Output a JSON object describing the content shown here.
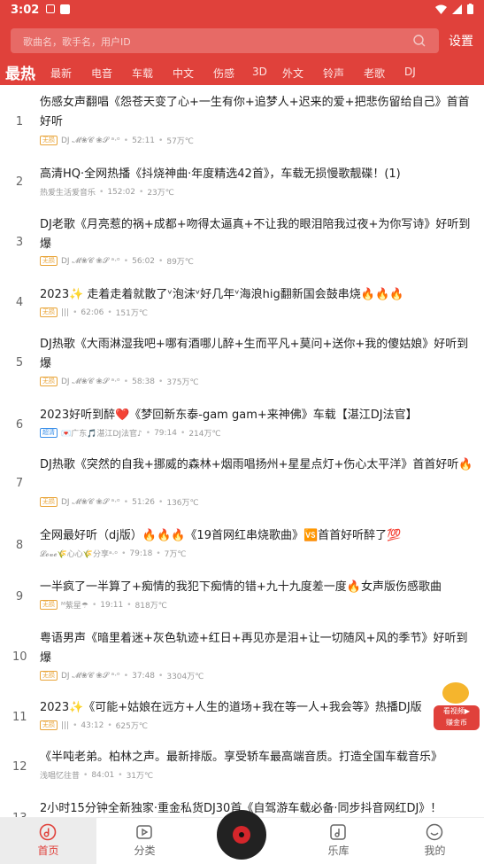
{
  "status_bar": {
    "time": "3:02"
  },
  "search": {
    "placeholder": "歌曲名，歌手名，用户ID"
  },
  "settings_label": "设置",
  "tabs": [
    "最热",
    "最新",
    "电音",
    "车载",
    "中文",
    "伤感",
    "3D",
    "外文",
    "铃声",
    "老歌",
    "DJ"
  ],
  "songs": [
    {
      "num": "1",
      "title": "伤感女声翻唱《怨苍天变了心+一生有你+追梦人+迟来的爱+把悲伤留给自己》首首好听",
      "badge": "无损",
      "uploader": "DJ 𝓜❀𝓒 ❀𝓢 ᵃ·ᵒ",
      "duration": "52:11",
      "plays": "57万℃"
    },
    {
      "num": "2",
      "title": "高清HQ·全网热播《抖烧神曲·年度精选42首》，车载无损慢歌靓碟！(1)",
      "badge": "",
      "uploader": "热爱生活爱音乐",
      "duration": "152:02",
      "plays": "23万℃"
    },
    {
      "num": "3",
      "title": "DJ老歌《月亮惹的祸+成都+吻得太逼真+不让我的眼泪陪我过夜+为你写诗》好听到爆",
      "badge": "无损",
      "uploader": "DJ 𝓜❀𝓒 ❀𝓢 ᵃ·ᵒ",
      "duration": "56:02",
      "plays": "89万℃"
    },
    {
      "num": "4",
      "title": "2023✨ 走着走着就散了ᵛ泡沫ᵛ好几年ᵛ海浪hig翻新国会鼓串烧🔥🔥🔥",
      "badge": "无损",
      "uploader": "|||",
      "duration": "62:06",
      "plays": "151万℃"
    },
    {
      "num": "5",
      "title": "DJ热歌《大雨淋湿我吧+哪有酒哪儿醉+生而平凡+莫问+送你+我的傻姑娘》好听到爆",
      "badge": "无损",
      "uploader": "DJ 𝓜❀𝓒 ❀𝓢 ᵃ·ᵒ",
      "duration": "58:38",
      "plays": "375万℃"
    },
    {
      "num": "6",
      "title": "2023好听到醉❤️《梦回新东泰-gam gam+来神佛》车载【湛江DJ法官】",
      "badge": "超清",
      "uploader": "💌广东🎵湛江DJ法官♪",
      "duration": "79:14",
      "plays": "214万℃"
    },
    {
      "num": "7",
      "title": "DJ热歌《突然的自我+挪威的森林+烟雨唱扬州+星星点灯+伤心太平洋》首首好听🔥",
      "badge": "无损",
      "uploader": "DJ 𝓜❀𝓒 ❀𝓢 ᵃ·ᵒ",
      "duration": "51:26",
      "plays": "136万℃"
    },
    {
      "num": "8",
      "title": "全网最好听（dj版）🔥🔥🔥《19首网红串烧歌曲》🆚首首好听醉了💯",
      "badge": "",
      "uploader": "𝓛𝓸𝓿𝓮🌾心心🌾分享ᵃ·ᵒ",
      "duration": "79:18",
      "plays": "7万℃"
    },
    {
      "num": "9",
      "title": "一半疯了一半算了+痴情的我犯下痴情的错+九十九度差一度🔥女声版伤感歌曲",
      "badge": "无损",
      "uploader": "ᴹ紫星☂",
      "duration": "19:11",
      "plays": "818万℃"
    },
    {
      "num": "10",
      "title": "粤语男声《暗里着迷+灰色轨迹+红日+再见亦是泪+让一切随风+风的季节》好听到爆",
      "badge": "无损",
      "uploader": "DJ 𝓜❀𝓒 ❀𝓢 ᵃ·ᵒ",
      "duration": "37:48",
      "plays": "3304万℃"
    },
    {
      "num": "11",
      "title": "2023✨《可能+姑娘在远方+人生的道场+我在等一人+我会等》热播DJ版",
      "badge": "无损",
      "uploader": "|||",
      "duration": "43:12",
      "plays": "625万℃"
    },
    {
      "num": "12",
      "title": "《半吨老弟。柏林之声。最新排版。享受轿车最高端音质。打造全国车载音乐》",
      "badge": "",
      "uploader": "浅唱忆往昔",
      "duration": "84:01",
      "plays": "31万℃"
    },
    {
      "num": "13",
      "title": "2小时15分钟全新独家·重金私货DJ30首《自驾游车载必备·同步抖音网红DJ》！",
      "badge": "",
      "uploader": "",
      "duration": "",
      "plays": ""
    }
  ],
  "float_promo": {
    "line1": "看视频▶",
    "line2": "赚金币"
  },
  "bottom_nav": [
    "首页",
    "分类",
    "乐库",
    "我的"
  ],
  "colors": {
    "brand": "#e0413b"
  }
}
